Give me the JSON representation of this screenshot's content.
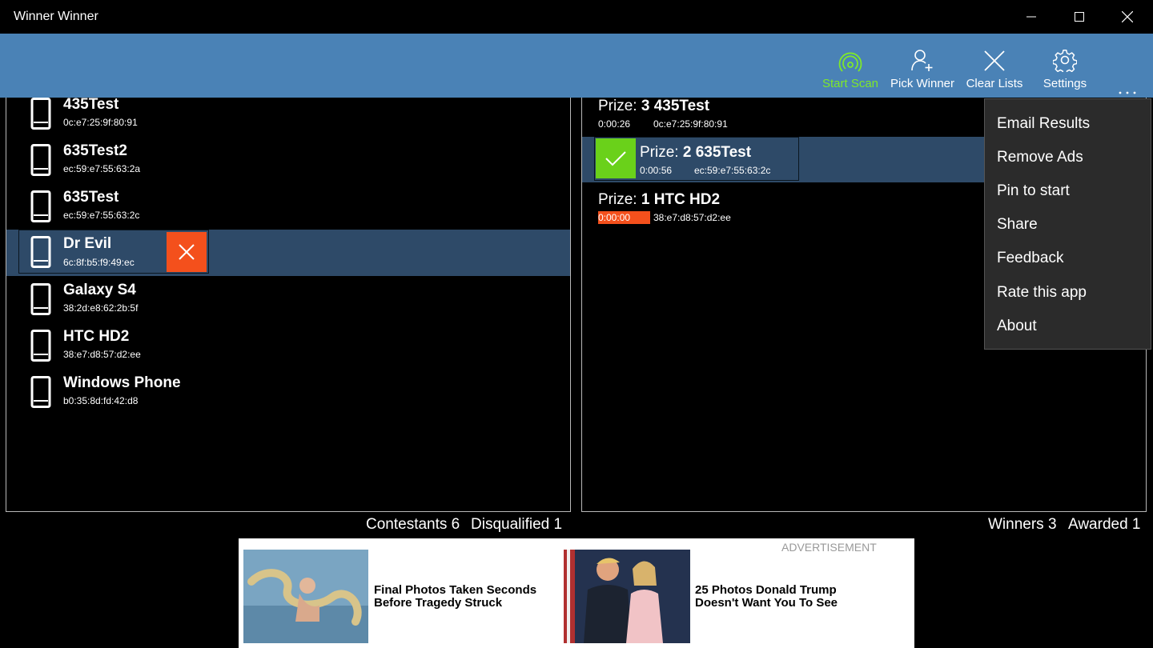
{
  "window": {
    "title": "Winner Winner"
  },
  "toolbar": {
    "start_scan": "Start Scan",
    "pick_winner": "Pick Winner",
    "clear_lists": "Clear Lists",
    "settings": "Settings",
    "accent_active": "#7fe82a",
    "background": "#4a82b6"
  },
  "contestants": [
    {
      "name": "435Test",
      "mac": "0c:e7:25:9f:80:91"
    },
    {
      "name": "635Test2",
      "mac": "ec:59:e7:55:63:2a"
    },
    {
      "name": "635Test",
      "mac": "ec:59:e7:55:63:2c"
    },
    {
      "name": "Dr Evil",
      "mac": "6c:8f:b5:f9:49:ec",
      "selected": true
    },
    {
      "name": "Galaxy S4",
      "mac": "38:2d:e8:62:2b:5f"
    },
    {
      "name": "HTC HD2",
      "mac": "38:e7:d8:57:d2:ee"
    },
    {
      "name": "Windows Phone",
      "mac": "b0:35:8d:fd:42:d8"
    }
  ],
  "prizes": [
    {
      "prefix": "Prize:",
      "name": "3 435Test",
      "time": "0:00:26",
      "mac": "0c:e7:25:9f:80:91"
    },
    {
      "prefix": "Prize:",
      "name": "2 635Test",
      "time": "0:00:56",
      "mac": "ec:59:e7:55:63:2c",
      "selected": true
    },
    {
      "prefix": "Prize:",
      "name": "1 HTC HD2",
      "time": "0:00:00",
      "mac": "38:e7:d8:57:d2:ee",
      "time_highlight": "#f4501c"
    }
  ],
  "menu": {
    "items": [
      "Email Results",
      "Remove Ads",
      "Pin to start",
      "Share",
      "Feedback",
      "Rate this app",
      "About"
    ]
  },
  "stats": {
    "contestants": "Contestants 6",
    "disqualified": "Disqualified 1",
    "winners": "Winners 3",
    "awarded": "Awarded 1"
  },
  "ad": {
    "label": "ADVERTISEMENT",
    "items": [
      {
        "headline": "Final Photos Taken Seconds Before Tragedy Struck"
      },
      {
        "headline": "25 Photos Donald Trump Doesn't Want You To See"
      }
    ]
  }
}
